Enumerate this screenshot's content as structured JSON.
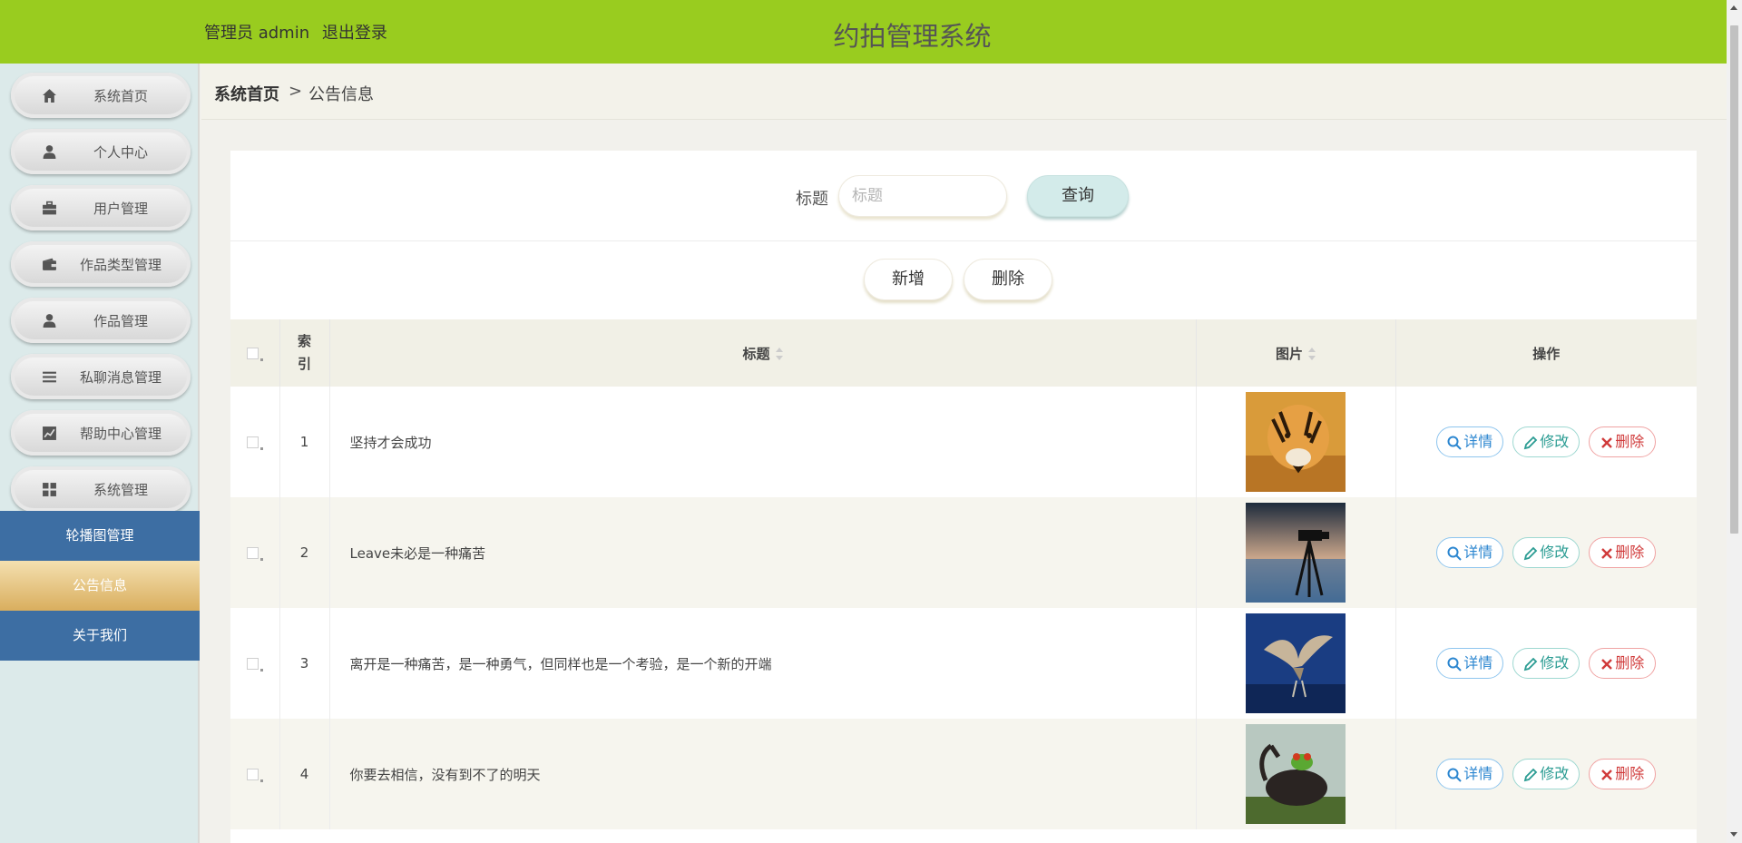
{
  "header": {
    "user": "管理员 admin",
    "logout": "退出登录",
    "title": "约拍管理系统"
  },
  "sidebar": {
    "menu": [
      {
        "label": "系统首页",
        "icon": "home-icon"
      },
      {
        "label": "个人中心",
        "icon": "user-icon"
      },
      {
        "label": "用户管理",
        "icon": "briefcase-icon"
      },
      {
        "label": "作品类型管理",
        "icon": "wallet-icon"
      },
      {
        "label": "作品管理",
        "icon": "user-icon"
      },
      {
        "label": "私聊消息管理",
        "icon": "list-icon"
      },
      {
        "label": "帮助中心管理",
        "icon": "chart-icon"
      },
      {
        "label": "系统管理",
        "icon": "grid-icon"
      }
    ],
    "submenu": [
      {
        "label": "轮播图管理",
        "active": false
      },
      {
        "label": "公告信息",
        "active": true
      },
      {
        "label": "关于我们",
        "active": false
      }
    ]
  },
  "breadcrumb": {
    "home": "系统首页",
    "separator": ">",
    "current": "公告信息"
  },
  "search": {
    "label": "标题",
    "placeholder": "标题",
    "button": "查询"
  },
  "actions": {
    "add": "新增",
    "delete": "删除"
  },
  "table": {
    "columns": {
      "index": "索引",
      "title": "标题",
      "image": "图片",
      "ops": "操作"
    },
    "ops": {
      "detail": "详情",
      "edit": "修改",
      "delete": "删除"
    },
    "rows": [
      {
        "index": "1",
        "title": "坚持才会成功",
        "image": "tiger"
      },
      {
        "index": "2",
        "title": "Leave未必是一种痛苦",
        "image": "tripod-camera"
      },
      {
        "index": "3",
        "title": "离开是一种痛苦，是一种勇气，但同样也是一个考验，是一个新的开端",
        "image": "bird"
      },
      {
        "index": "4",
        "title": "你要去相信，没有到不了的明天",
        "image": "frog-beetle"
      }
    ]
  },
  "colors": {
    "header_bg": "#99cc1f",
    "submenu_blue": "#3d6ea3",
    "submenu_active": "#d9ae5e"
  }
}
